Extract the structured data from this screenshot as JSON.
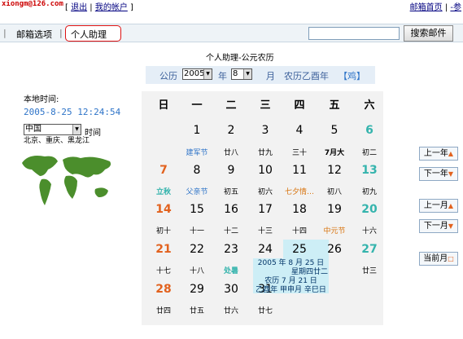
{
  "header": {
    "email": "xiongm@126.com",
    "logout": "退出",
    "my_account": "我的帐户",
    "mailbox_home": "邮箱首页",
    "cut_link": "-参"
  },
  "nav": {
    "mail_options": "邮箱选项",
    "personal_assistant": "个人助理",
    "search_placeholder": "",
    "search_button": "搜索邮件"
  },
  "page_title": "个人助理-公元农历",
  "selector": {
    "gregorian_label": "公历",
    "year": "2005",
    "year_unit": "年",
    "month": "8",
    "month_unit": "月",
    "lunar_year": "农历乙酉年",
    "zodiac": "【鸡】"
  },
  "local": {
    "label": "本地时间:",
    "time": "2005-8-25 12:24:54",
    "city": "中国",
    "time_label": "时间",
    "cities": "北京、重庆、黑龙江"
  },
  "calendar": {
    "headers": [
      "日",
      "一",
      "二",
      "三",
      "四",
      "五",
      "六"
    ],
    "rows": [
      {
        "days": [
          "",
          "1",
          "2",
          "3",
          "4",
          "5",
          "6"
        ],
        "lunar": [
          "",
          "建军节",
          "廿八",
          "廿九",
          "三十",
          "7月大",
          "初二"
        ]
      },
      {
        "days": [
          "7",
          "8",
          "9",
          "10",
          "11",
          "12",
          "13"
        ],
        "lunar": [
          "立秋",
          "父亲节",
          "初五",
          "初六",
          "七夕情…",
          "初八",
          "初九"
        ]
      },
      {
        "days": [
          "14",
          "15",
          "16",
          "17",
          "18",
          "19",
          "20"
        ],
        "lunar": [
          "初十",
          "十一",
          "十二",
          "十三",
          "十四",
          "中元节",
          "十六"
        ]
      },
      {
        "days": [
          "21",
          "22",
          "23",
          "24",
          "25",
          "26",
          "27"
        ],
        "lunar": [
          "十七",
          "十八",
          "处暑",
          "",
          "",
          "",
          "廿三"
        ]
      },
      {
        "days": [
          "28",
          "29",
          "30",
          "31",
          "",
          "",
          ""
        ],
        "lunar": [
          "廿四",
          "廿五",
          "廿六",
          "廿七",
          "",
          "",
          ""
        ]
      }
    ],
    "popup": {
      "line1": "2005 年 8 月 25 日",
      "line2": "星期四",
      "line3": "农历 7 月 21 日",
      "line4": "乙酉年 甲申月 辛巳日",
      "partial_day": "廿二"
    }
  },
  "buttons": {
    "prev_year": "上一年",
    "next_year": "下一年",
    "prev_month": "上一月",
    "next_month": "下一月",
    "current_month": "当前月"
  },
  "colors": {
    "accent": "#2e74c8",
    "weekend": "#e2621e",
    "saturday": "#35b4ad",
    "today": "#cdeef6"
  }
}
